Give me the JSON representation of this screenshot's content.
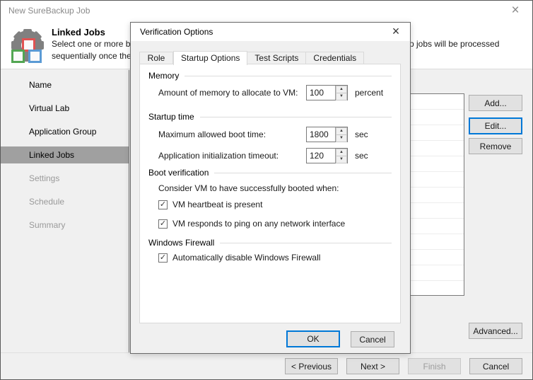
{
  "window": {
    "title": "New SureBackup Job",
    "close_icon": "×"
  },
  "banner": {
    "heading": "Linked Jobs",
    "description_line1_left": "Select one or more b",
    "description_line1_right": "p jobs will be processed",
    "description_line2_left": "sequentially once the"
  },
  "sidebar": {
    "items": [
      {
        "label": "Name",
        "state": "done"
      },
      {
        "label": "Virtual Lab",
        "state": "done"
      },
      {
        "label": "Application Group",
        "state": "done"
      },
      {
        "label": "Linked Jobs",
        "state": "selected"
      },
      {
        "label": "Settings",
        "state": "disabled"
      },
      {
        "label": "Schedule",
        "state": "disabled"
      },
      {
        "label": "Summary",
        "state": "disabled"
      }
    ]
  },
  "main": {
    "buttons": {
      "add": "Add...",
      "edit": "Edit...",
      "remove": "Remove",
      "advanced": "Advanced..."
    },
    "footer_buttons": {
      "previous": "< Previous",
      "next": "Next >",
      "finish": "Finish",
      "cancel": "Cancel"
    }
  },
  "dialog": {
    "title": "Verification Options",
    "close_icon": "×",
    "tabs": [
      {
        "label": "Role"
      },
      {
        "label": "Startup Options"
      },
      {
        "label": "Test Scripts"
      },
      {
        "label": "Credentials"
      }
    ],
    "memory": {
      "header": "Memory",
      "label": "Amount of memory to allocate to VM:",
      "value": "100",
      "unit": "percent"
    },
    "startup": {
      "header": "Startup time",
      "boot_label": "Maximum allowed boot time:",
      "boot_value": "1800",
      "boot_unit": "sec",
      "init_label": "Application initialization timeout:",
      "init_value": "120",
      "init_unit": "sec"
    },
    "boot_verification": {
      "header": "Boot verification",
      "intro": "Consider VM to have successfully booted when:",
      "cb1": "VM heartbeat is present",
      "cb2": "VM responds to ping on any network interface"
    },
    "firewall": {
      "header": "Windows Firewall",
      "cb1": "Automatically disable Windows Firewall"
    },
    "ok_label": "OK",
    "cancel_label": "Cancel"
  },
  "icons": {
    "checkmark": "✓",
    "spin_up": "▲",
    "spin_down": "▼"
  },
  "colors": {
    "accent": "#0078d7",
    "selected_step_bg": "#a0a0a0",
    "gear_gray": "#808080"
  }
}
